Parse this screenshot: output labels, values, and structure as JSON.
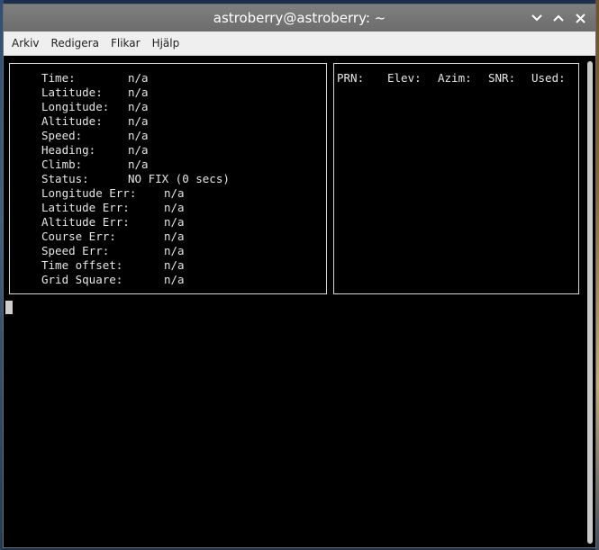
{
  "window": {
    "title": "astroberry@astroberry: ~",
    "buttons": [
      "minimize-icon",
      "maximize-icon",
      "close-icon"
    ]
  },
  "menubar": {
    "items": [
      "Arkiv",
      "Redigera",
      "Flikar",
      "Hjälp"
    ]
  },
  "gps": {
    "rows": [
      {
        "label": "Time:",
        "value": "n/a"
      },
      {
        "label": "Latitude:",
        "value": "n/a"
      },
      {
        "label": "Longitude:",
        "value": "n/a"
      },
      {
        "label": "Altitude:",
        "value": "n/a"
      },
      {
        "label": "Speed:",
        "value": "n/a"
      },
      {
        "label": "Heading:",
        "value": "n/a"
      },
      {
        "label": "Climb:",
        "value": "n/a"
      },
      {
        "label": "Status:",
        "value": "NO FIX (0 secs)"
      },
      {
        "label": "Longitude Err:",
        "value": "n/a"
      },
      {
        "label": "Latitude Err:",
        "value": "n/a"
      },
      {
        "label": "Altitude Err:",
        "value": "n/a"
      },
      {
        "label": "Course Err:",
        "value": "n/a"
      },
      {
        "label": "Speed Err:",
        "value": "n/a"
      },
      {
        "label": "Time offset:",
        "value": "n/a"
      },
      {
        "label": "Grid Square:",
        "value": "n/a"
      }
    ]
  },
  "satellites": {
    "headers": [
      "PRN:",
      "Elev:",
      "Azim:",
      "SNR:",
      "Used:"
    ]
  },
  "colors": {
    "terminal_bg": "#000000",
    "terminal_fg": "#e6e6e6",
    "titlebar": "#757575",
    "menubar": "#efefef"
  }
}
